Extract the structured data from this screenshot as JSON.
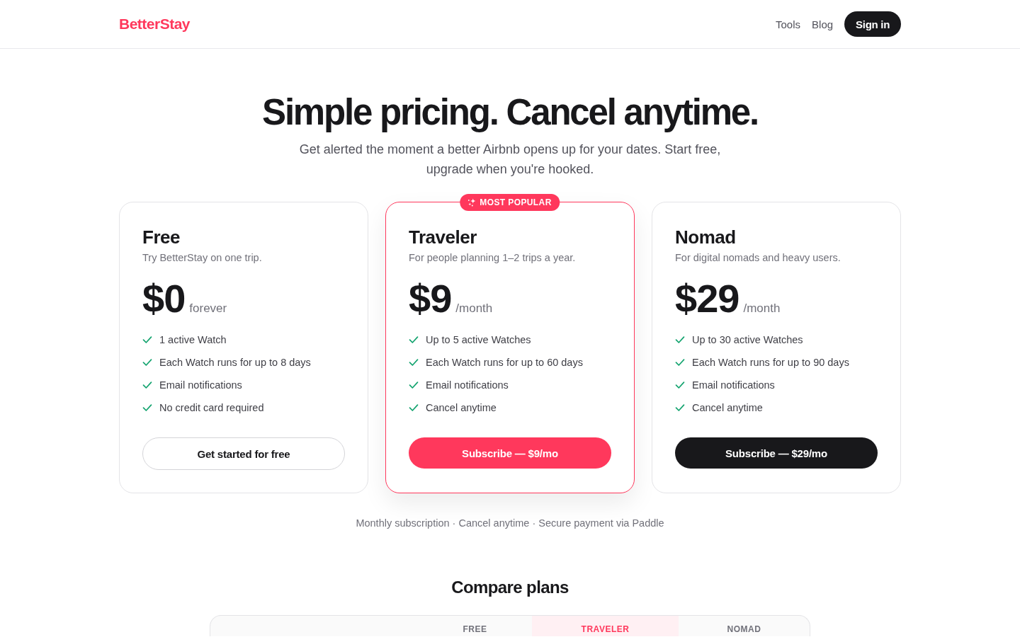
{
  "header": {
    "logo": "BetterStay",
    "nav": [
      "Tools",
      "Blog"
    ],
    "sign_in": "Sign in"
  },
  "hero": {
    "title": "Simple pricing. Cancel anytime.",
    "subtitle": "Get alerted the moment a better Airbnb opens up for your dates. Start free, upgrade when you're hooked."
  },
  "plans": [
    {
      "name": "Free",
      "description": "Try BetterStay on one trip.",
      "price": "$0",
      "period": "forever",
      "featured": false,
      "features": [
        "1 active Watch",
        "Each Watch runs for up to 8 days",
        "Email notifications",
        "No credit card required"
      ],
      "button": {
        "label": "Get started for free",
        "kind": "outline"
      }
    },
    {
      "name": "Traveler",
      "description": "For people planning 1–2 trips a year.",
      "price": "$9",
      "period": "/month",
      "featured": true,
      "badge": "MOST POPULAR",
      "features": [
        "Up to 5 active Watches",
        "Each Watch runs for up to 60 days",
        "Email notifications",
        "Cancel anytime"
      ],
      "button": {
        "label": "Subscribe — $9/mo",
        "kind": "accent"
      }
    },
    {
      "name": "Nomad",
      "description": "For digital nomads and heavy users.",
      "price": "$29",
      "period": "/month",
      "featured": false,
      "features": [
        "Up to 30 active Watches",
        "Each Watch runs for up to 90 days",
        "Email notifications",
        "Cancel anytime"
      ],
      "button": {
        "label": "Subscribe — $29/mo",
        "kind": "dark"
      }
    }
  ],
  "note": "Monthly subscription · Cancel anytime · Secure payment via Paddle",
  "compare": {
    "title": "Compare plans",
    "columns": [
      {
        "label": "FREE",
        "highlighted": false
      },
      {
        "label": "TRAVELER",
        "highlighted": true
      },
      {
        "label": "NOMAD",
        "highlighted": false
      }
    ]
  }
}
